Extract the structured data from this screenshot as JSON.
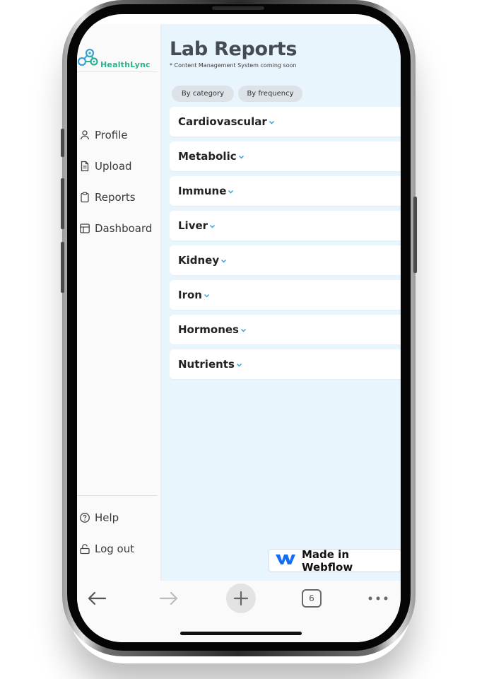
{
  "app": {
    "brand": "HealthLync",
    "brand_color": "#2ab38b",
    "accent_blue": "#3aa0d8"
  },
  "sidebar": {
    "items": [
      {
        "label": "Profile",
        "icon": "user-icon"
      },
      {
        "label": "Upload",
        "icon": "document-icon"
      },
      {
        "label": "Reports",
        "icon": "clipboard-icon"
      },
      {
        "label": "Dashboard",
        "icon": "layout-icon"
      }
    ],
    "footer_items": [
      {
        "label": "Help",
        "icon": "help-circle-icon"
      },
      {
        "label": "Log out",
        "icon": "unlock-icon"
      }
    ]
  },
  "main": {
    "title": "Lab Reports",
    "subtitle": "* Content Management System coming soon",
    "filters": [
      "By category",
      "By frequency"
    ],
    "categories": [
      "Cardiovascular",
      "Metabolic",
      "Immune",
      "Liver",
      "Kidney",
      "Iron",
      "Hormones",
      "Nutrients"
    ]
  },
  "badge": {
    "label": "Made in Webflow",
    "icon": "webflow-logo-icon"
  },
  "browser": {
    "tab_count": "6",
    "icons": [
      "back-arrow-icon",
      "forward-arrow-icon",
      "plus-icon",
      "tabs-icon",
      "more-icon"
    ]
  }
}
